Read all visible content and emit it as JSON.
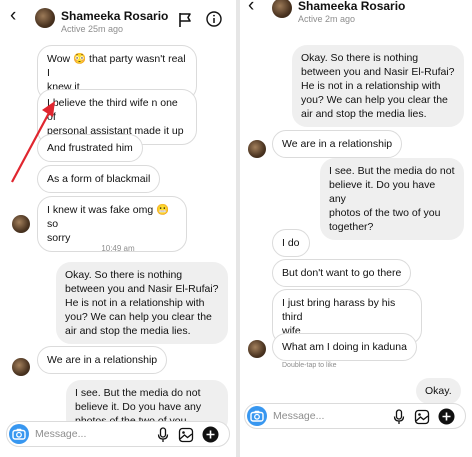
{
  "header": {
    "contact_name": "Shameeka Rosario",
    "status": "Active 25m ago",
    "status_right": "Active 2m ago"
  },
  "left": {
    "incoming_1": [
      "Wow 😳 that party wasn't real I",
      "knew it"
    ],
    "incoming_2": [
      "I believe the third wife n one of",
      "personal assistant made it up"
    ],
    "incoming_3": "And frustrated him",
    "incoming_4": "As a form of blackmail",
    "incoming_5": [
      "I knew it was fake omg 😬 so",
      "sorry"
    ],
    "timestamp": "10:49 am",
    "outgoing_1": [
      "Okay. So there is nothing",
      "between you and Nasir El-Rufai?",
      "He is not in a relationship with",
      "you? We can help you clear the",
      "air and stop the media lies."
    ],
    "incoming_6": "We are in a relationship",
    "outgoing_2": [
      "I see. But the media do not",
      "believe it. Do you have any",
      "photos of the two of you"
    ]
  },
  "right": {
    "outgoing_1": [
      "Okay. So there is nothing",
      "between you and Nasir El-Rufai?",
      "He is not in a relationship with",
      "you? We can help you clear the",
      "air and stop the media lies."
    ],
    "incoming_1": "We are in a relationship",
    "outgoing_2": [
      "I see. But the media do not",
      "believe it. Do you have any",
      "photos of the two of you",
      "together?"
    ],
    "incoming_2": "I do",
    "incoming_3": "But don't want to go there",
    "incoming_4": [
      "I just bring harass by his third",
      "wife"
    ],
    "incoming_5": "What am I doing in kaduna",
    "hint": "Double-tap to like",
    "outgoing_3": "Okay."
  },
  "composer": {
    "placeholder": "Message..."
  },
  "colors": {
    "accent": "#3897f0",
    "incoming_border": "#dbdbdb",
    "outgoing_bg": "#efefef",
    "arrow": "#e0262f"
  },
  "icons": [
    "back-arrow-icon",
    "flag-icon",
    "info-icon",
    "camera-icon",
    "microphone-icon",
    "gallery-icon",
    "add-icon"
  ]
}
